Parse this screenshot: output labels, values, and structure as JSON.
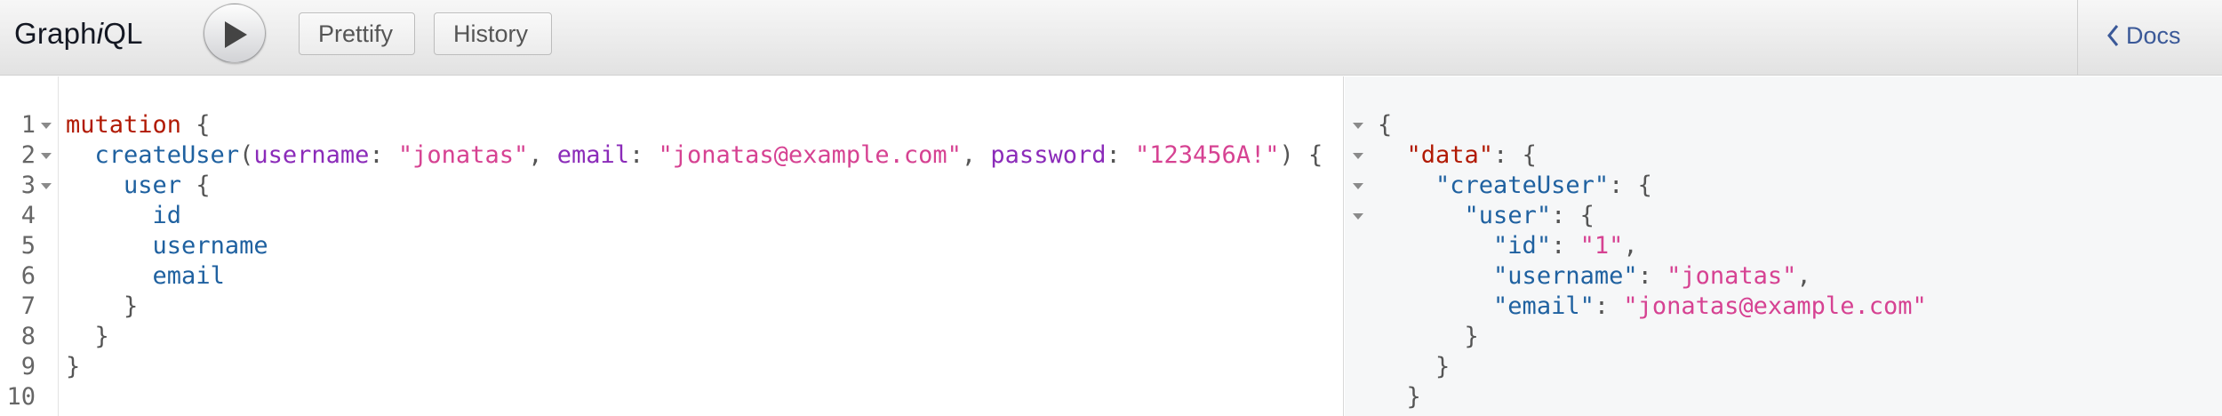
{
  "app": {
    "title_prefix": "Graph",
    "title_italic": "i",
    "title_suffix": "QL"
  },
  "toolbar": {
    "execute_label": "",
    "prettify_label": "Prettify",
    "history_label": "History",
    "docs_label": "Docs"
  },
  "editor": {
    "line_numbers": [
      "1",
      "2",
      "3",
      "4",
      "5",
      "6",
      "7",
      "8",
      "9",
      "10"
    ],
    "lines": {
      "l1_keyword": "mutation",
      "l1_brace": " {",
      "l2_field": "createUser",
      "l2_open": "(",
      "l2_arg1": "username",
      "l2_colon1": ": ",
      "l2_val1": "\"jonatas\"",
      "l2_comma1": ", ",
      "l2_arg2": "email",
      "l2_colon2": ": ",
      "l2_val2": "\"jonatas@example.com\"",
      "l2_comma2": ", ",
      "l2_arg3": "password",
      "l2_colon3": ": ",
      "l2_val3": "\"123456A!\"",
      "l2_close": ") {",
      "l3_field": "user",
      "l3_brace": " {",
      "l4_field": "id",
      "l5_field": "username",
      "l6_field": "email",
      "l7_close": "}",
      "l8_close": "}",
      "l9_close": "}"
    }
  },
  "result": {
    "r1": "{",
    "r2_key": "\"data\"",
    "r2_rest": ": {",
    "r3_key": "\"createUser\"",
    "r3_rest": ": {",
    "r4_key": "\"user\"",
    "r4_rest": ": {",
    "r5_key": "\"id\"",
    "r5_colon": ": ",
    "r5_val": "\"1\"",
    "r5_comma": ",",
    "r6_key": "\"username\"",
    "r6_colon": ": ",
    "r6_val": "\"jonatas\"",
    "r6_comma": ",",
    "r7_key": "\"email\"",
    "r7_colon": ": ",
    "r7_val": "\"jonatas@example.com\"",
    "r8": "}",
    "r9": "}",
    "r10": "}"
  },
  "colors": {
    "keyword": "#b11a04",
    "field": "#1f61a0",
    "argument": "#8b2bb9",
    "string": "#d64292",
    "docs_link": "#3b5998"
  }
}
